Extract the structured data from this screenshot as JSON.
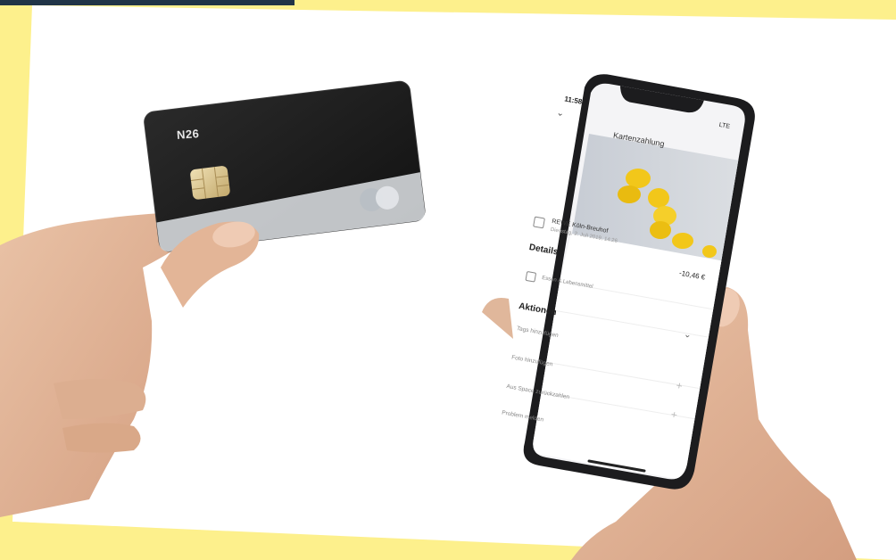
{
  "card": {
    "brand": "N26"
  },
  "phone": {
    "status_time": "11:58",
    "status_right": "LTE",
    "title": "Kartenzahlung",
    "merchant": {
      "name": "REWE Köln-Breuhof",
      "date": "Dienstag, 2. Juli 2019, 14:26"
    },
    "details_label": "Details",
    "amount": "-10,46 €",
    "category": "Essen & Lebensmittel",
    "actions_label": "Aktionen",
    "actions": [
      "Tags hinzufügen",
      "Foto hinzufügen",
      "Aus Space zurückzahlen",
      "Problem melden"
    ]
  },
  "colors": {
    "frame_yellow": "#fdf08c",
    "card_black": "#1b1b1b",
    "chip_gold": "#d9c48f",
    "lemon_yellow": "#f2c71a",
    "phone_body": "#1c1c1e"
  }
}
